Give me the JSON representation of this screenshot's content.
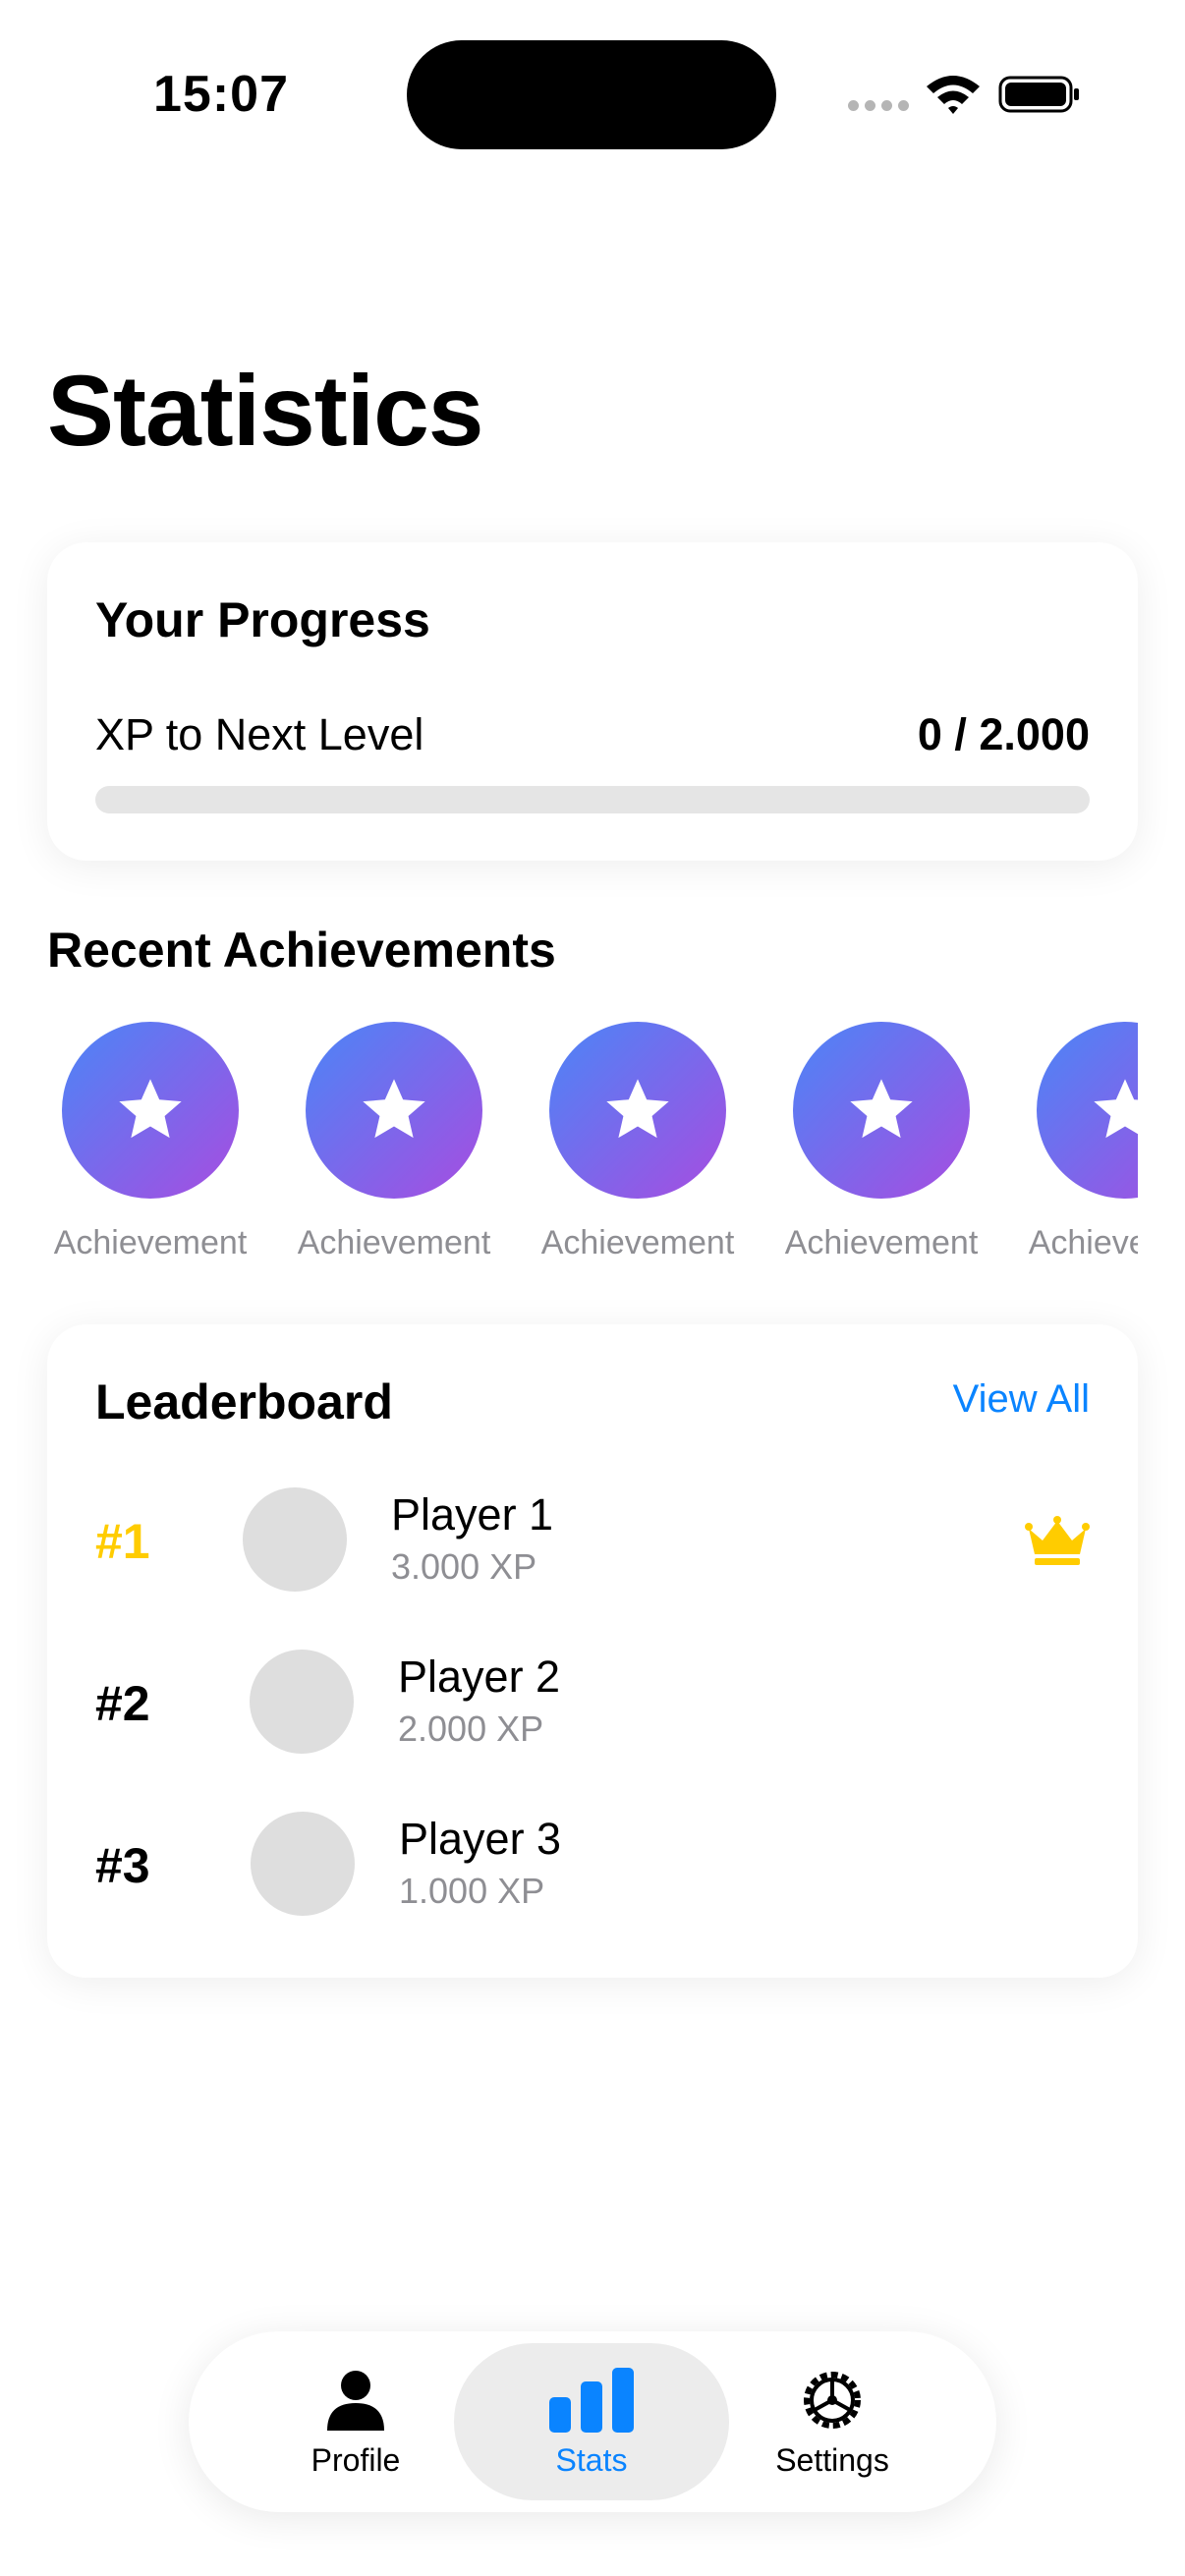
{
  "status_bar": {
    "time": "15:07"
  },
  "page": {
    "title": "Statistics"
  },
  "progress": {
    "title": "Your Progress",
    "xp_label": "XP to Next Level",
    "xp_value": "0 / 2.000",
    "fraction": 0
  },
  "achievements": {
    "title": "Recent Achievements",
    "items": [
      {
        "label": "Achievement",
        "icon": "star-icon"
      },
      {
        "label": "Achievement",
        "icon": "star-icon"
      },
      {
        "label": "Achievement",
        "icon": "star-icon"
      },
      {
        "label": "Achievement",
        "icon": "star-icon"
      },
      {
        "label": "Achievement",
        "icon": "star-icon"
      }
    ]
  },
  "leaderboard": {
    "title": "Leaderboard",
    "view_all": "View All",
    "players": [
      {
        "rank": "#1",
        "name": "Player 1",
        "xp": "3.000 XP",
        "crown": true
      },
      {
        "rank": "#2",
        "name": "Player 2",
        "xp": "2.000 XP",
        "crown": false
      },
      {
        "rank": "#3",
        "name": "Player 3",
        "xp": "1.000 XP",
        "crown": false
      }
    ]
  },
  "tab_bar": {
    "tabs": [
      {
        "label": "Profile",
        "icon": "person-icon",
        "active": false
      },
      {
        "label": "Stats",
        "icon": "bar-chart-icon",
        "active": true
      },
      {
        "label": "Settings",
        "icon": "gear-icon",
        "active": false
      }
    ]
  },
  "colors": {
    "accent": "#0a84ff",
    "gold": "#ffcc00",
    "secondary_text": "#8e8e93"
  }
}
